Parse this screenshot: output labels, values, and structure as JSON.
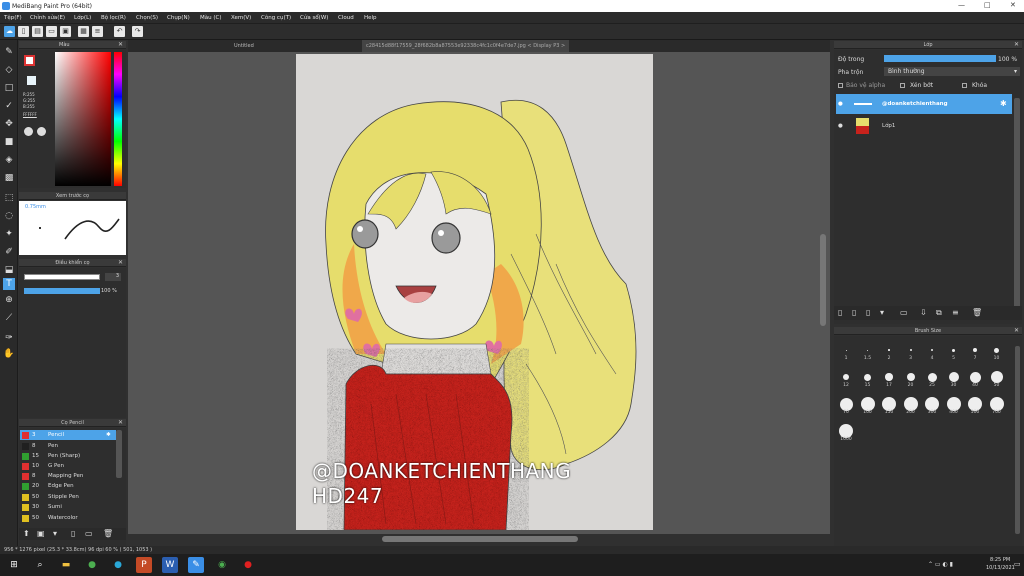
{
  "app": {
    "title": "MediBang Paint Pro (64bit)"
  },
  "window_controls": {
    "minimize": "—",
    "maximize": "□",
    "close": "✕"
  },
  "menu": [
    "Tệp(F)",
    "Chỉnh sửa(E)",
    "Lớp(L)",
    "Bộ lọc(R)",
    "Chọn(S)",
    "Chụp(N)",
    "Màu (C)",
    "Xem(V)",
    "Công cụ(T)",
    "Cửa sổ(W)",
    "Cloud",
    "Help"
  ],
  "tabs": {
    "untitled": "Untitled",
    "file": "c28415d88f17559_28f682b8a87553e92338c4fc1c0f4e7de7.jpg < Display P3 >"
  },
  "color_panel": {
    "title": "Màu",
    "r": "R:255",
    "g": "G:255",
    "b": "B:255",
    "hex": "FFFFFF"
  },
  "brush_preview": {
    "title": "Xem trước cọ",
    "size": "0.75mm"
  },
  "brush_control": {
    "title": "Điều khiển cọ",
    "size_value": "3",
    "opacity": "100 %"
  },
  "brush_list": {
    "title": "Cọ Pencil",
    "items": [
      {
        "size": "3",
        "name": "Pencil",
        "color": "#e03030"
      },
      {
        "size": "8",
        "name": "Pen",
        "color": "#202020"
      },
      {
        "size": "15",
        "name": "Pen (Sharp)",
        "color": "#30a030"
      },
      {
        "size": "10",
        "name": "G Pen",
        "color": "#e03030"
      },
      {
        "size": "8",
        "name": "Mapping Pen",
        "color": "#e03030"
      },
      {
        "size": "20",
        "name": "Edge Pen",
        "color": "#30a030"
      },
      {
        "size": "50",
        "name": "Stipple Pen",
        "color": "#e0c020"
      },
      {
        "size": "30",
        "name": "Sumi",
        "color": "#e0c020"
      },
      {
        "size": "50",
        "name": "Watercolor",
        "color": "#e0c020"
      }
    ]
  },
  "layers_panel": {
    "title": "Lớp",
    "opacity_label": "Độ trong",
    "opacity_value": "100 %",
    "blend_label": "Pha trộn",
    "blend_value": "Bình thường",
    "protect_alpha": "Bảo vệ alpha",
    "clipping": "Xén bớt",
    "lock": "Khóa",
    "layers": [
      {
        "name": "@doanketchienthang",
        "selected": true
      },
      {
        "name": "Lớp1",
        "selected": false
      }
    ]
  },
  "brush_size": {
    "title": "Brush Size",
    "labels": [
      "1",
      "1.5",
      "2",
      "3",
      "4",
      "5",
      "7",
      "10",
      "12",
      "15",
      "17",
      "20",
      "25",
      "30",
      "40",
      "50",
      "70",
      "100",
      "150",
      "200",
      "300",
      "400",
      "500",
      "700",
      "1000"
    ]
  },
  "artwork": {
    "watermark_line1": "@DOANKETCHIENTHANG",
    "watermark_line2": "HD247"
  },
  "status": {
    "text": "956 * 1276 pixel   (25.3 * 33.8cm)   96 dpi   60 %   ( 501, 1053 )"
  },
  "taskbar": {
    "time": "8:25 PM",
    "date": "10/13/2021"
  }
}
